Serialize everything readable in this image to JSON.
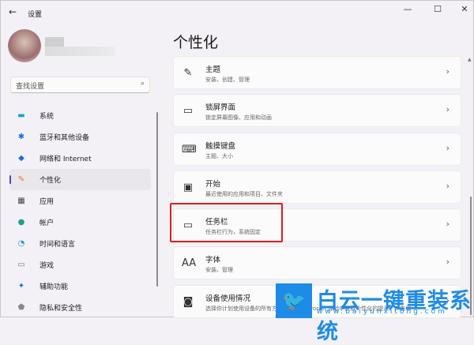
{
  "window": {
    "title": "设置",
    "back": "←",
    "minimize": "—",
    "maximize": "☐",
    "close": "✕"
  },
  "search": {
    "placeholder": "查找设置",
    "icon": "⌕"
  },
  "sidebar": {
    "items": [
      {
        "label": "系统",
        "icon": "▬",
        "color": "#1a9ed9"
      },
      {
        "label": "蓝牙和其他设备",
        "icon": "✱",
        "color": "#1670e0"
      },
      {
        "label": "网络和 Internet",
        "icon": "◆",
        "color": "#1670e0"
      },
      {
        "label": "个性化",
        "icon": "✎",
        "color": "#e8743a"
      },
      {
        "label": "应用",
        "icon": "▦",
        "color": "#444"
      },
      {
        "label": "帐户",
        "icon": "●",
        "color": "#1aa38b"
      },
      {
        "label": "时间和语言",
        "icon": "◔",
        "color": "#1a8ed9"
      },
      {
        "label": "游戏",
        "icon": "▭",
        "color": "#777"
      },
      {
        "label": "辅助功能",
        "icon": "✦",
        "color": "#1670e0"
      },
      {
        "label": "隐私和安全性",
        "icon": "⬟",
        "color": "#888"
      }
    ]
  },
  "page": {
    "title": "个性化"
  },
  "cards": [
    {
      "title": "主题",
      "subtitle": "安装、创建、管理",
      "icon": "✎"
    },
    {
      "title": "锁屏界面",
      "subtitle": "锁定屏幕图像、应用和动画",
      "icon": "▭"
    },
    {
      "title": "触摸键盘",
      "subtitle": "主题、大小",
      "icon": "⌨"
    },
    {
      "title": "开始",
      "subtitle": "最近使用的应用和项目、文件夹",
      "icon": "▣"
    },
    {
      "title": "任务栏",
      "subtitle": "任务栏行为，系统固定",
      "icon": "▭"
    },
    {
      "title": "字体",
      "subtitle": "安装、管理",
      "icon": "AA"
    },
    {
      "title": "设备使用情况",
      "subtitle": "选择你计划使用设备的所有方式，以在 Microsoft 体验中获取个性化的提示、广告和",
      "icon": "◙"
    }
  ],
  "chevron": "›",
  "watermark": {
    "name": "白云一键重装系统",
    "url": "www.baiyunxitong.com",
    "icon": "🐦"
  }
}
